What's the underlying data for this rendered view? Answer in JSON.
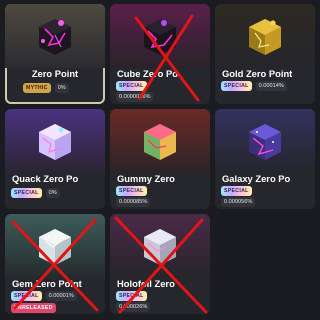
{
  "items": [
    {
      "name": "Zero Point",
      "badge": "MYTHIC",
      "chance": "0%",
      "icon": "cube-dark-pink-icon"
    },
    {
      "name": "Cube Zero Po",
      "badge": "SPECIAL",
      "chance": "0.0000016%",
      "icon": "cube-dark-pink-icon"
    },
    {
      "name": "Gold Zero Point",
      "badge": "SPECIAL",
      "chance": "0.00014%",
      "icon": "cube-gold-icon"
    },
    {
      "name": "Quack Zero Po",
      "badge": "SPECIAL",
      "chance": "0%",
      "icon": "cube-iridescent-icon"
    },
    {
      "name": "Gummy Zero",
      "badge": "SPECIAL",
      "chance": "0.000085%",
      "icon": "cube-gummy-icon"
    },
    {
      "name": "Galaxy Zero Po",
      "badge": "SPECIAL",
      "chance": "0.000056%",
      "icon": "cube-galaxy-icon"
    },
    {
      "name": "Gem Zero Point",
      "badge": "SPECIAL",
      "chance": "0.00001%",
      "extra_badge": "UNRELEASED",
      "icon": "cube-gem-icon"
    },
    {
      "name": "Holofoil Zero",
      "badge": "SPECIAL",
      "chance": "0.000026%",
      "icon": "cube-holofoil-icon"
    }
  ],
  "colors": {
    "cross": "#e01515",
    "selected_border": "#cfc9b0"
  }
}
